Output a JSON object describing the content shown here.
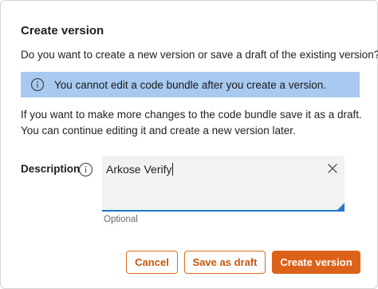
{
  "dialog": {
    "title": "Create version",
    "question": "Do you want to create a new version or save a draft of the existing version?",
    "info_banner": {
      "icon": "info-icon",
      "text": "You cannot edit a code bundle after you create a version."
    },
    "paragraph_lines": [
      "If you want to make more changes to the code bundle save it as a draft.",
      "You can continue editing it and create a new version later."
    ],
    "description_field": {
      "label": "Description",
      "info_icon": "info-icon",
      "value": "Arkose Verify",
      "hint": "Optional",
      "clear_icon": "close-icon"
    },
    "buttons": {
      "cancel": "Cancel",
      "save_draft": "Save as draft",
      "create": "Create version"
    }
  },
  "colors": {
    "accent": "#dc6219",
    "banner": "#a8c9f0",
    "focus": "#1f77c9"
  }
}
